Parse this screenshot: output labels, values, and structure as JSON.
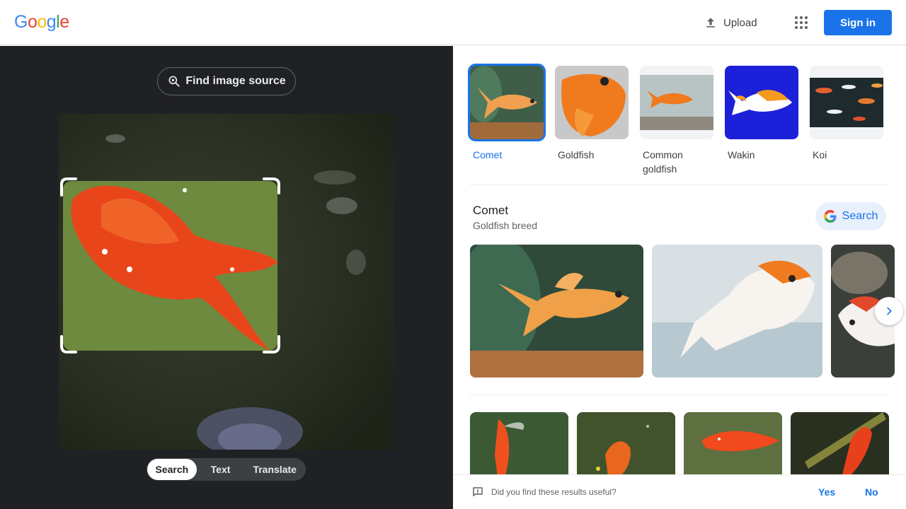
{
  "header": {
    "logo": {
      "letters": [
        "G",
        "o",
        "o",
        "g",
        "l",
        "e"
      ],
      "colors": [
        "#4285f4",
        "#ea4335",
        "#fbbc05",
        "#4285f4",
        "#34a853",
        "#ea4335"
      ]
    },
    "upload_label": "Upload",
    "apps_icon": "apps-grid-icon",
    "signin_label": "Sign in"
  },
  "left": {
    "find_source_label": "Find image source",
    "modes": [
      {
        "label": "Search",
        "active": true
      },
      {
        "label": "Text",
        "active": false
      },
      {
        "label": "Translate",
        "active": false
      }
    ]
  },
  "results": {
    "chips": [
      {
        "label": "Comet",
        "selected": true
      },
      {
        "label": "Goldfish",
        "selected": false
      },
      {
        "label": "Common goldfish",
        "selected": false
      },
      {
        "label": "Wakin",
        "selected": false
      },
      {
        "label": "Koi",
        "selected": false
      }
    ],
    "knowledge": {
      "title": "Comet",
      "subtitle": "Goldfish breed",
      "search_label": "Search"
    },
    "feedback": {
      "question": "Did you find these results useful?",
      "yes": "Yes",
      "no": "No"
    }
  },
  "colors": {
    "accent": "#1a73e8",
    "dark_panel": "#202124"
  }
}
